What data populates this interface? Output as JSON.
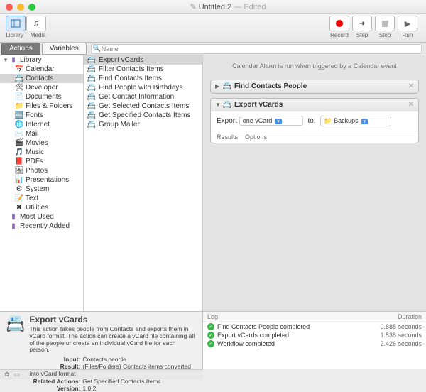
{
  "window": {
    "title": "Untitled 2",
    "edited": "— Edited"
  },
  "toolbar": {
    "library": "Library",
    "media": "Media",
    "record": "Record",
    "step": "Step",
    "stop": "Stop",
    "run": "Run"
  },
  "tabs": {
    "actions": "Actions",
    "variables": "Variables"
  },
  "search": {
    "placeholder": "Name"
  },
  "library": {
    "root": "Library",
    "items": [
      {
        "label": "Calendar",
        "icon": "📅"
      },
      {
        "label": "Contacts",
        "icon": "📇",
        "sel": true
      },
      {
        "label": "Developer",
        "icon": "🛠"
      },
      {
        "label": "Documents",
        "icon": "📄"
      },
      {
        "label": "Files & Folders",
        "icon": "📁"
      },
      {
        "label": "Fonts",
        "icon": "🔤"
      },
      {
        "label": "Internet",
        "icon": "🌐"
      },
      {
        "label": "Mail",
        "icon": "✉️"
      },
      {
        "label": "Movies",
        "icon": "🎬"
      },
      {
        "label": "Music",
        "icon": "🎵"
      },
      {
        "label": "PDFs",
        "icon": "📕"
      },
      {
        "label": "Photos",
        "icon": "🖼"
      },
      {
        "label": "Presentations",
        "icon": "📊"
      },
      {
        "label": "System",
        "icon": "⚙"
      },
      {
        "label": "Text",
        "icon": "📝"
      },
      {
        "label": "Utilities",
        "icon": "✖"
      }
    ],
    "mostUsed": "Most Used",
    "recentlyAdded": "Recently Added"
  },
  "actions": [
    {
      "label": "Export vCards",
      "sel": true
    },
    {
      "label": "Filter Contacts Items"
    },
    {
      "label": "Find Contacts Items"
    },
    {
      "label": "Find People with Birthdays"
    },
    {
      "label": "Get Contact Information"
    },
    {
      "label": "Get Selected Contacts Items"
    },
    {
      "label": "Get Specified Contacts Items"
    },
    {
      "label": "Group Mailer"
    }
  ],
  "canvas": {
    "info": "Calendar Alarm is run when triggered by a Calendar event",
    "step1": {
      "title": "Find Contacts People"
    },
    "step2": {
      "title": "Export vCards",
      "exportLabel": "Export",
      "exportValue": "one vCard",
      "toLabel": "to:",
      "toValue": "Backups",
      "resultsTab": "Results",
      "optionsTab": "Options"
    }
  },
  "info": {
    "title": "Export vCards",
    "desc": "This action takes people from Contacts and exports them in vCard format. The action can create a vCard file containing all of the people or create an individual vCard file for each person.",
    "inputL": "Input:",
    "input": "Contacts people",
    "resultL": "Result:",
    "result": "(Files/Folders) Contacts items converted into vCard format",
    "relatedL": "Related Actions:",
    "related": "Get Specified Contacts Items",
    "versionL": "Version:",
    "version": "1.0.2"
  },
  "log": {
    "col1": "Log",
    "col2": "Duration",
    "rows": [
      {
        "msg": "Find Contacts People completed",
        "dur": "0.888 seconds"
      },
      {
        "msg": "Export vCards completed",
        "dur": "1.538 seconds"
      },
      {
        "msg": "Workflow completed",
        "dur": "2.426 seconds"
      }
    ]
  }
}
